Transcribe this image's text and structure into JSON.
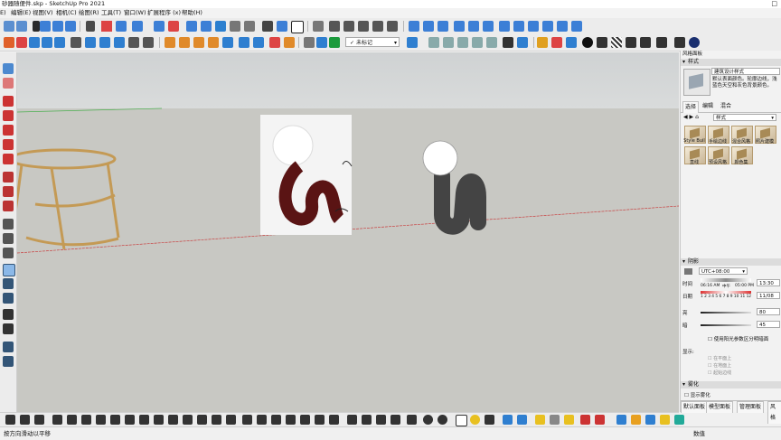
{
  "window": {
    "title": "砂器随便件.skp - SketchUp Pro 2021",
    "close_glyph": "□"
  },
  "menu": [
    "E)",
    "编辑(E)",
    "视图(V)",
    "相机(C)",
    "绘图(R)",
    "工具(T)",
    "窗口(W)",
    "扩展程序 (x)",
    "帮助(H)"
  ],
  "toolbar": {
    "tag_select": "未标记"
  },
  "tray": {
    "title": "风格面板",
    "styles": {
      "header": "样式",
      "name": "建筑设计样式",
      "description": "默认表面颜色。轮廓边线，浅蓝色天空和灰色背景颜色。",
      "tabs": [
        "选择",
        "编辑",
        "混合"
      ],
      "collection": "样式",
      "thumbs": [
        "Style Buil",
        "手绘边线",
        "混合风格",
        "照片建模",
        "直线",
        "预设风格",
        "颜色集"
      ]
    },
    "shadows": {
      "header": "阴影",
      "timezone": "UTC+08:00",
      "time_label": "时间",
      "date_label": "日期",
      "time_min": "06:16 AM",
      "time_noon": "中午",
      "time_max": "05:00 PM",
      "time_value": "13:30",
      "date_value": "11/08",
      "months": "1 2 3 4 5 6 7 8 9 10 11 12",
      "light_label": "亮",
      "light_value": "80",
      "dark_label": "暗",
      "dark_value": "45",
      "sun_shading": "使用阳光参数区分明暗面",
      "display_label": "显示:",
      "on_faces": "在平面上",
      "on_ground": "在地面上",
      "from_edges": "起始边线"
    },
    "fog": {
      "header": "雾化",
      "show_fog": "显示雾化"
    },
    "bottom_tabs": [
      "默认面板",
      "模型面板",
      "管理面板",
      "风格"
    ]
  },
  "status": {
    "hint": "按方向滑动以平移",
    "measure_label": "数值"
  },
  "colors": {
    "sky": "#cfd2d3",
    "ground": "#c8c8c3",
    "accent_blue": "#1f6fd0"
  }
}
